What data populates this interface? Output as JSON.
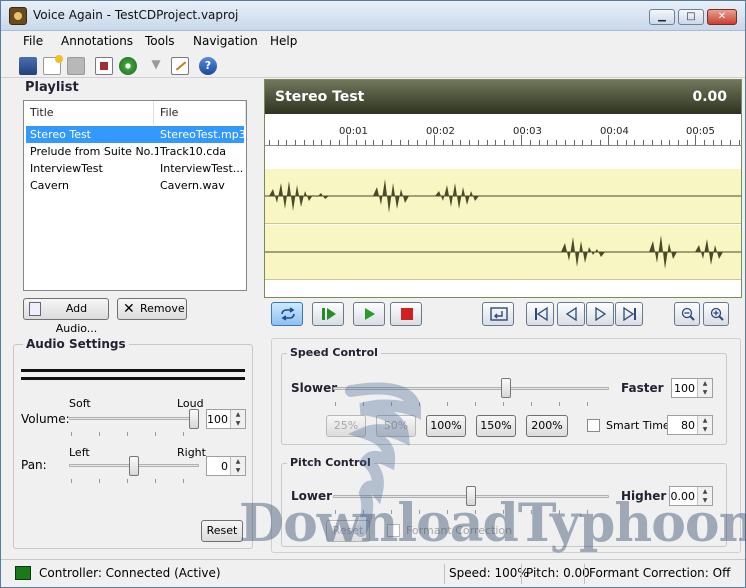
{
  "window": {
    "title": "Voice Again - TestCDProject.vaproj",
    "minimize": "▁",
    "maximize": "□",
    "close": "✕"
  },
  "menu": [
    "File",
    "Annotations",
    "Tools",
    "Navigation",
    "Help"
  ],
  "toolbar_icons": [
    "new-project-icon",
    "open-icon",
    "save-icon",
    "export-icon",
    "cd-icon",
    "filter-icon",
    "edit-icon",
    "help-icon"
  ],
  "playlist": {
    "title": "Playlist",
    "columns": [
      "Title",
      "File"
    ],
    "rows": [
      {
        "title": "Stereo Test",
        "file": "StereoTest.mp3",
        "selected": true
      },
      {
        "title": "Prelude from Suite No.1...",
        "file": "Track10.cda",
        "selected": false
      },
      {
        "title": "InterviewTest",
        "file": "InterviewTest....",
        "selected": false
      },
      {
        "title": "Cavern",
        "file": "Cavern.wav",
        "selected": false
      }
    ],
    "add_label": "Add Audio...",
    "remove_label": "Remove"
  },
  "audio_settings": {
    "title": "Audio Settings",
    "volume_label": "Volume:",
    "soft": "Soft",
    "loud": "Loud",
    "volume_value": "100",
    "volume_level": 1.0,
    "pan_label": "Pan:",
    "left": "Left",
    "right": "Right",
    "pan_value": "0",
    "pan_level": 0.5,
    "reset": "Reset"
  },
  "track": {
    "name": "Stereo Test",
    "time": "0.00",
    "ruler": [
      "00:01",
      "00:02",
      "00:03",
      "00:04",
      "00:05"
    ]
  },
  "speed": {
    "title": "Speed Control",
    "slower": "Slower",
    "faster": "Faster",
    "value": "100",
    "level": 0.63,
    "presets": [
      "25%",
      "50%",
      "100%",
      "150%",
      "200%"
    ],
    "disabled": [
      "25%",
      "50%"
    ],
    "smart_time_label": "Smart Time:",
    "smart_time_value": "80"
  },
  "pitch": {
    "title": "Pitch Control",
    "lower": "Lower",
    "higher": "Higher",
    "value": "0.00",
    "level": 0.5,
    "reset": "Reset",
    "formant_label": "Formant Correction"
  },
  "watermark": "DownloadTyphoon",
  "status": {
    "controller": "Controller: Connected (Active)",
    "speed": "Speed: 100%",
    "pitch": "Pitch: 0.00",
    "formant": "Formant Correction: Off",
    "accent": "#1a7a1a"
  }
}
